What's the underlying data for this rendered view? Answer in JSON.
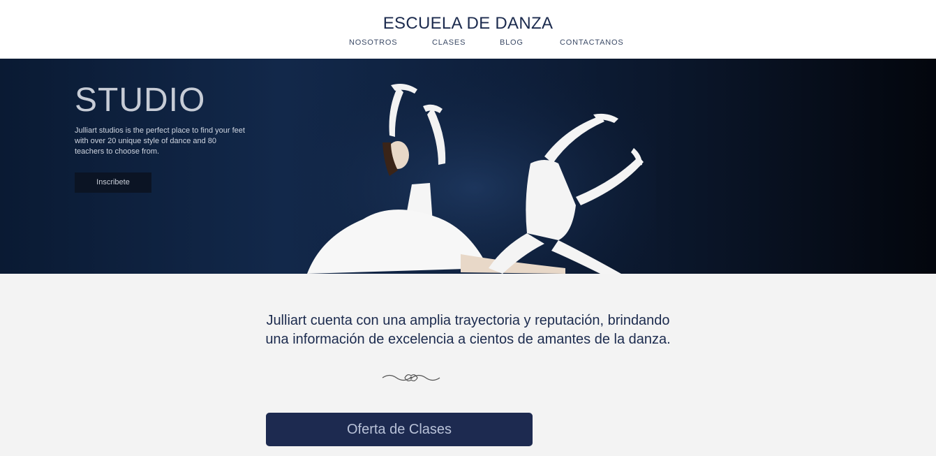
{
  "header": {
    "brand": "ESCUELA DE DANZA",
    "nav": [
      {
        "label": "NOSOTROS"
      },
      {
        "label": "CLASES"
      },
      {
        "label": "BLOG"
      },
      {
        "label": "CONTACTANOS"
      }
    ]
  },
  "hero": {
    "title": "STUDIO",
    "text": "Julliart studios is the perfect place to find your feet with over 20 unique style of dance and 80 teachers to choose from.",
    "button_label": "Inscribete"
  },
  "main": {
    "tagline_line1": "Julliart cuenta con una amplia trayectoria y reputación, brindando",
    "tagline_line2": "una información de excelencia a cientos de amantes de la danza.",
    "cta_label": "Oferta de Clases"
  },
  "colors": {
    "brand_navy": "#1c2b4e",
    "button_navy": "#1d2a50",
    "page_background": "#f3f3f3"
  }
}
